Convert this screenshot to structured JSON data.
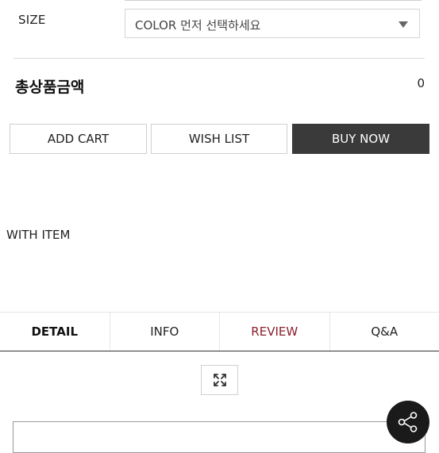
{
  "option": {
    "size_label": "SIZE",
    "size_select_value": "COLOR 먼저 선택하세요"
  },
  "total": {
    "label": "총상품금액",
    "value": "0"
  },
  "actions": {
    "add_cart": "ADD CART",
    "wish_list": "WISH LIST",
    "buy_now": "BUY NOW"
  },
  "with_item": {
    "title": "WITH ITEM"
  },
  "tabs": [
    {
      "label": "DETAIL"
    },
    {
      "label": "INFO"
    },
    {
      "label": "REVIEW"
    },
    {
      "label": "Q&A"
    }
  ],
  "icons": {
    "expand": "expand-arrows-icon",
    "share": "share-icon",
    "caret": "chevron-down-icon"
  },
  "colors": {
    "primary_button": "#3a3a3a",
    "review_tab": "#8b1e2a",
    "share_fab": "#1a1a1a"
  }
}
